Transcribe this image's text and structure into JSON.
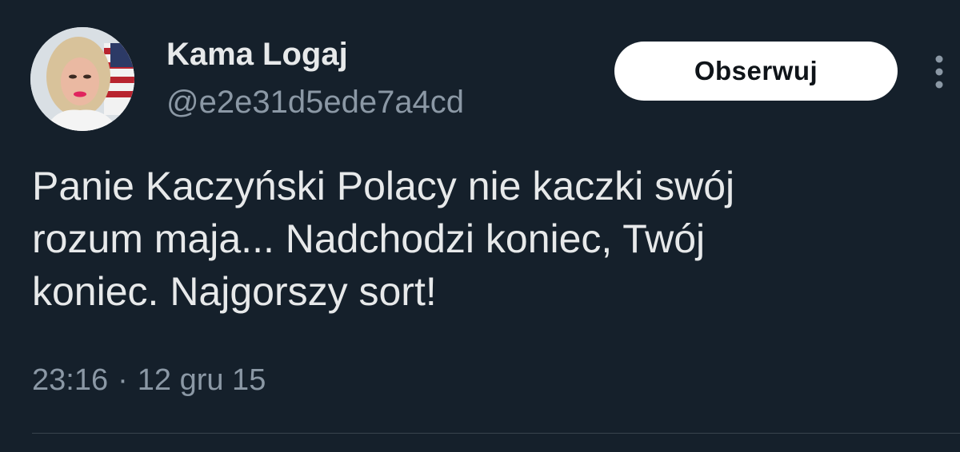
{
  "author": {
    "display_name": "Kama Logaj",
    "handle": "@e2e31d5ede7a4cd",
    "avatar_icon": "profile-photo"
  },
  "actions": {
    "follow_label": "Obserwuj",
    "more_icon": "more-vertical-icon"
  },
  "tweet": {
    "text_lines": [
      "Panie Kaczyński Polacy nie kaczki swój",
      "rozum maja... Nadchodzi koniec, Twój",
      "koniec. Najgorszy sort!"
    ],
    "time": "23:16",
    "separator": "·",
    "date": "12 gru 15"
  },
  "colors": {
    "background": "#15202b",
    "primary_text": "#e7e9ea",
    "secondary_text": "#8b98a5",
    "button_bg": "#ffffff",
    "button_text": "#0f1419",
    "divider": "#38444d"
  }
}
